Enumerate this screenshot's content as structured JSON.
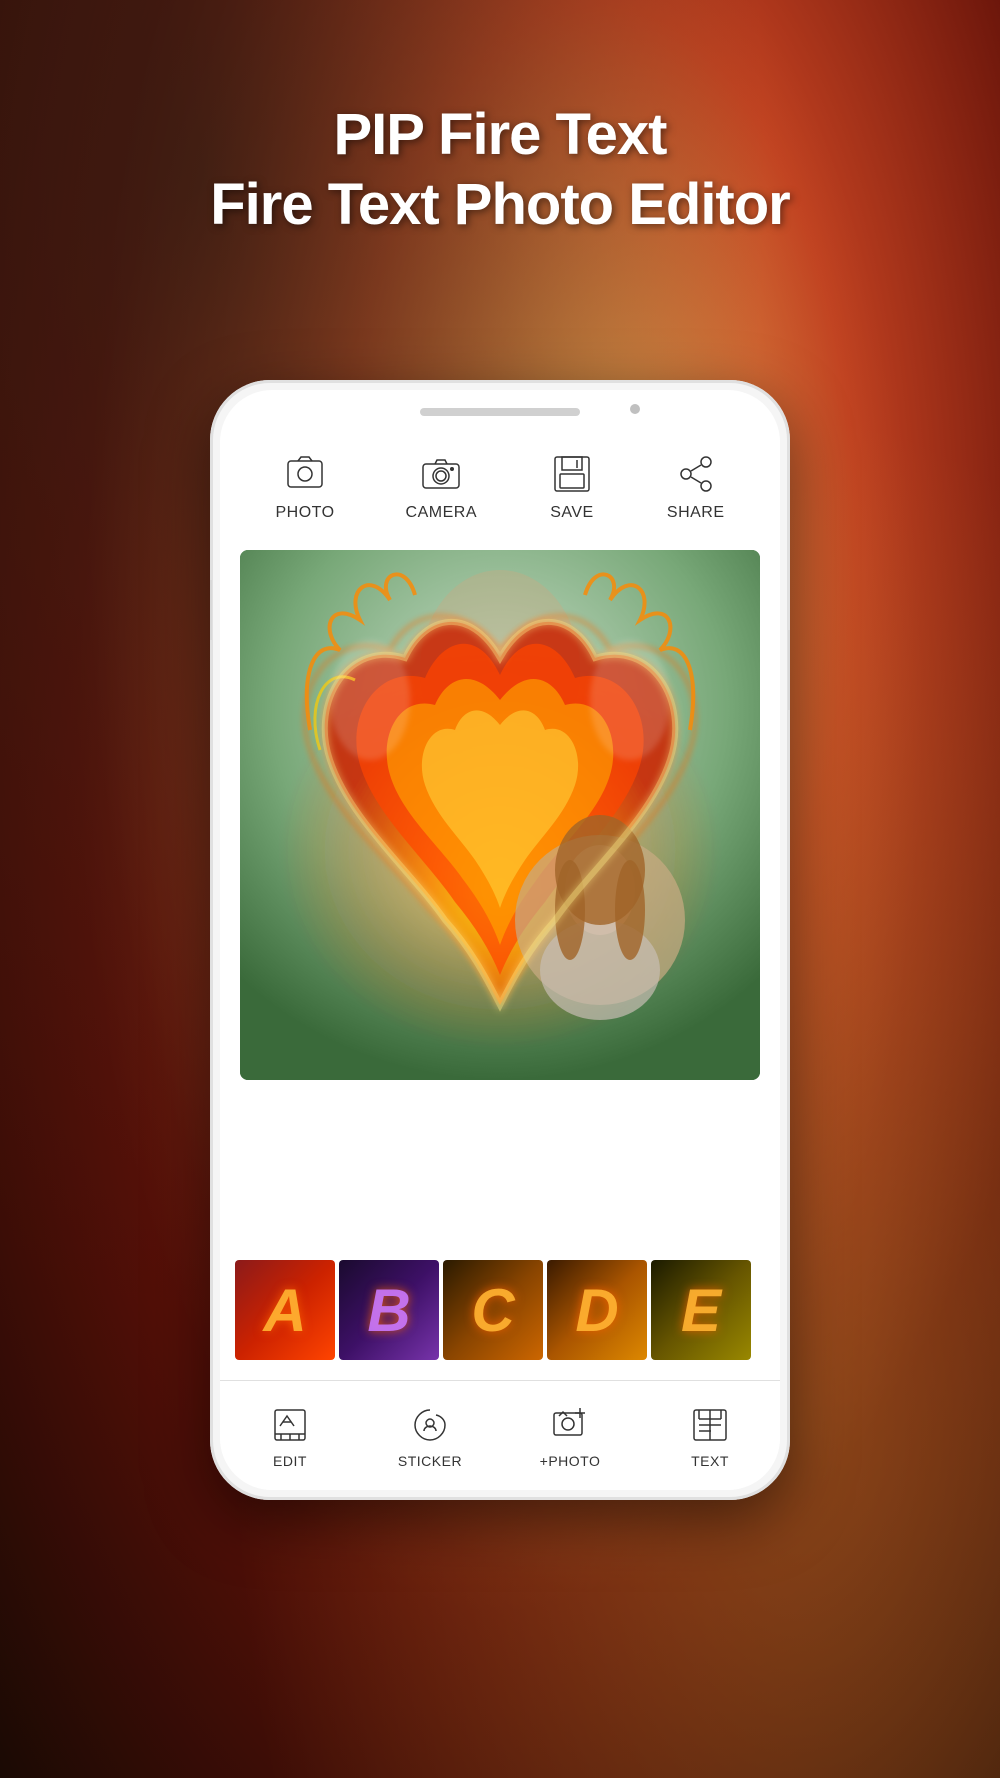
{
  "app": {
    "title_line1": "PIP Fire Text",
    "title_line2": "Fire Text Photo Editor"
  },
  "toolbar": {
    "items": [
      {
        "id": "photo",
        "label": "PHOTO",
        "icon": "photo-icon"
      },
      {
        "id": "camera",
        "label": "CAMERA",
        "icon": "camera-icon"
      },
      {
        "id": "save",
        "label": "SAVE",
        "icon": "save-icon"
      },
      {
        "id": "share",
        "label": "SHARE",
        "icon": "share-icon"
      }
    ]
  },
  "thumbnails": [
    {
      "letter": "A",
      "id": "thumb-a"
    },
    {
      "letter": "B",
      "id": "thumb-b"
    },
    {
      "letter": "C",
      "id": "thumb-c"
    },
    {
      "letter": "D",
      "id": "thumb-d"
    },
    {
      "letter": "E",
      "id": "thumb-e"
    }
  ],
  "bottom_nav": {
    "items": [
      {
        "id": "edit",
        "label": "EDIT",
        "icon": "edit-icon"
      },
      {
        "id": "sticker",
        "label": "STICKER",
        "icon": "sticker-icon"
      },
      {
        "id": "add-photo",
        "label": "+PHOTO",
        "icon": "add-photo-icon"
      },
      {
        "id": "text",
        "label": "TEXT",
        "icon": "text-icon"
      }
    ]
  }
}
